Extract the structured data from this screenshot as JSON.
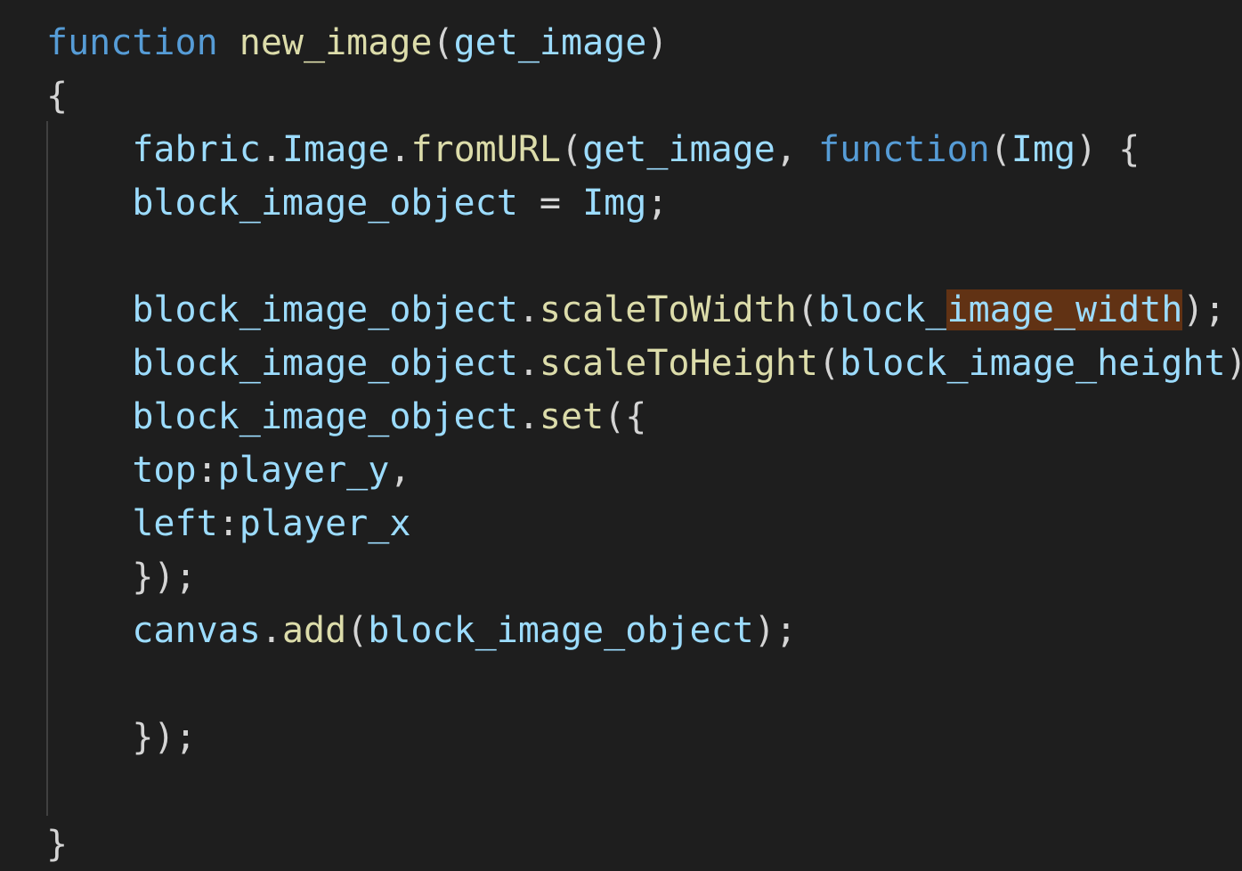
{
  "editor": {
    "lines": [
      [
        {
          "text": "function",
          "kind": "keyword"
        },
        {
          "text": " ",
          "kind": "punct"
        },
        {
          "text": "new_image",
          "kind": "function"
        },
        {
          "text": "(",
          "kind": "punct"
        },
        {
          "text": "get_image",
          "kind": "variable"
        },
        {
          "text": ")",
          "kind": "punct"
        }
      ],
      [
        {
          "text": "{",
          "kind": "punct"
        }
      ],
      [
        {
          "text": "    ",
          "kind": "punct"
        },
        {
          "text": "fabric",
          "kind": "variable"
        },
        {
          "text": ".",
          "kind": "punct"
        },
        {
          "text": "Image",
          "kind": "variable"
        },
        {
          "text": ".",
          "kind": "punct"
        },
        {
          "text": "fromURL",
          "kind": "function"
        },
        {
          "text": "(",
          "kind": "punct"
        },
        {
          "text": "get_image",
          "kind": "variable"
        },
        {
          "text": ", ",
          "kind": "punct"
        },
        {
          "text": "function",
          "kind": "keyword"
        },
        {
          "text": "(",
          "kind": "punct"
        },
        {
          "text": "Img",
          "kind": "variable"
        },
        {
          "text": ") {",
          "kind": "punct"
        }
      ],
      [
        {
          "text": "    ",
          "kind": "punct"
        },
        {
          "text": "block_image_object",
          "kind": "variable"
        },
        {
          "text": " = ",
          "kind": "punct"
        },
        {
          "text": "Img",
          "kind": "variable"
        },
        {
          "text": ";",
          "kind": "punct"
        }
      ],
      [],
      [
        {
          "text": "    ",
          "kind": "punct"
        },
        {
          "text": "block_image_object",
          "kind": "variable"
        },
        {
          "text": ".",
          "kind": "punct"
        },
        {
          "text": "scaleToWidth",
          "kind": "function"
        },
        {
          "text": "(",
          "kind": "punct"
        },
        {
          "text": "block_",
          "kind": "variable"
        },
        {
          "text": "image_width",
          "kind": "variable",
          "highlight": true
        },
        {
          "text": ");",
          "kind": "punct"
        }
      ],
      [
        {
          "text": "    ",
          "kind": "punct"
        },
        {
          "text": "block_image_object",
          "kind": "variable"
        },
        {
          "text": ".",
          "kind": "punct"
        },
        {
          "text": "scaleToHeight",
          "kind": "function"
        },
        {
          "text": "(",
          "kind": "punct"
        },
        {
          "text": "block_image_height",
          "kind": "variable"
        },
        {
          "text": ");",
          "kind": "punct"
        }
      ],
      [
        {
          "text": "    ",
          "kind": "punct"
        },
        {
          "text": "block_image_object",
          "kind": "variable"
        },
        {
          "text": ".",
          "kind": "punct"
        },
        {
          "text": "set",
          "kind": "function"
        },
        {
          "text": "({",
          "kind": "punct"
        }
      ],
      [
        {
          "text": "    ",
          "kind": "punct"
        },
        {
          "text": "top",
          "kind": "variable"
        },
        {
          "text": ":",
          "kind": "punct"
        },
        {
          "text": "player_y",
          "kind": "variable"
        },
        {
          "text": ",",
          "kind": "punct"
        }
      ],
      [
        {
          "text": "    ",
          "kind": "punct"
        },
        {
          "text": "left",
          "kind": "variable"
        },
        {
          "text": ":",
          "kind": "punct"
        },
        {
          "text": "player_x",
          "kind": "variable"
        }
      ],
      [
        {
          "text": "    ",
          "kind": "punct"
        },
        {
          "text": "});",
          "kind": "punct"
        }
      ],
      [
        {
          "text": "    ",
          "kind": "punct"
        },
        {
          "text": "canvas",
          "kind": "variable"
        },
        {
          "text": ".",
          "kind": "punct"
        },
        {
          "text": "add",
          "kind": "function"
        },
        {
          "text": "(",
          "kind": "punct"
        },
        {
          "text": "block_image_object",
          "kind": "variable"
        },
        {
          "text": ");",
          "kind": "punct"
        }
      ],
      [],
      [
        {
          "text": "    ",
          "kind": "punct"
        },
        {
          "text": "});",
          "kind": "punct"
        }
      ],
      [],
      [
        {
          "text": "}",
          "kind": "punct"
        }
      ]
    ]
  },
  "colors": {
    "background": "#1e1e1e",
    "keyword": "#569cd6",
    "function": "#dcdcaa",
    "variable": "#9cdcfe",
    "punct": "#d4d4d4",
    "selection_highlight": "#613214",
    "indent_guide": "#404040"
  }
}
